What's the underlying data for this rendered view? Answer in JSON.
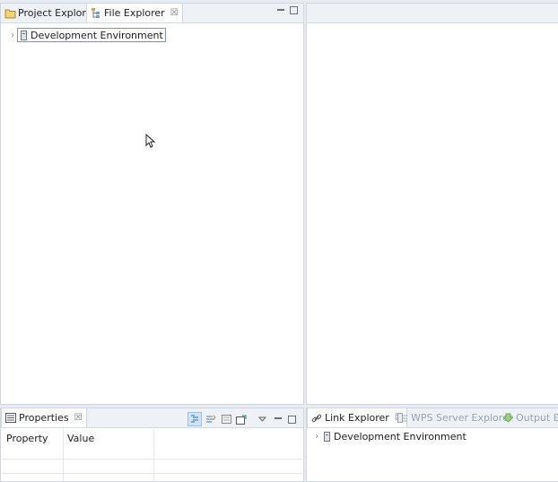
{
  "left_pane": {
    "tabs": [
      {
        "label": "Project Explorer",
        "active": false
      },
      {
        "label": "File Explorer",
        "active": true
      }
    ],
    "tree": [
      {
        "label": "Development Environment",
        "expanded": false
      }
    ]
  },
  "properties_pane": {
    "tab_label": "Properties",
    "columns": [
      "Property",
      "Value"
    ]
  },
  "bottom_right_pane": {
    "tabs": [
      {
        "label": "Link Explorer",
        "active": true
      },
      {
        "label": "WPS Server Explorer",
        "active": false
      },
      {
        "label": "Output Exp",
        "active": false
      }
    ],
    "tree": [
      {
        "label": "Development Environment",
        "expanded": false
      }
    ]
  },
  "colors": {
    "accent": "#cfe3f7",
    "tab_bar": "#eef2f7",
    "border": "#cfd6e0"
  }
}
